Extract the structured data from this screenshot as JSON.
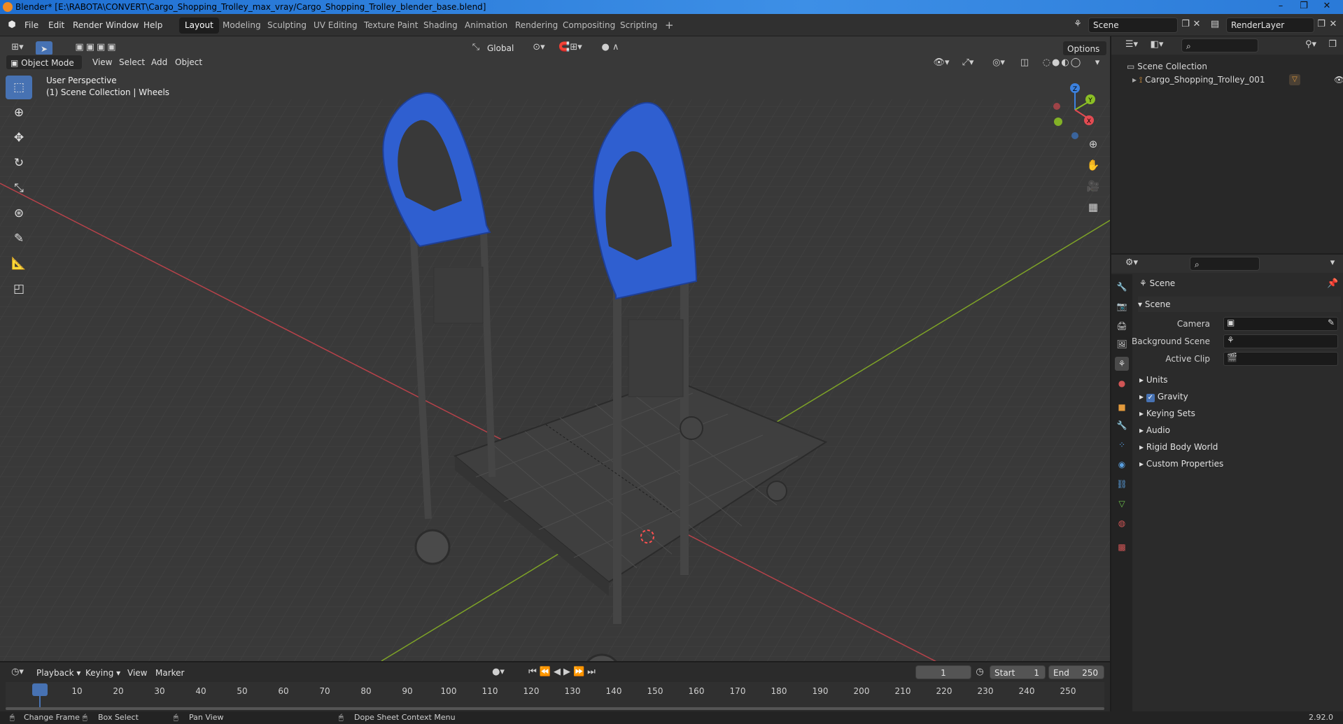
{
  "window": {
    "title": "Blender* [E:\\RABOTA\\CONVERT\\Cargo_Shopping_Trolley_max_vray/Cargo_Shopping_Trolley_blender_base.blend]",
    "controls": [
      "–",
      "❐",
      "✕"
    ]
  },
  "menu": [
    "File",
    "Edit",
    "Render",
    "Window",
    "Help"
  ],
  "workspaces": [
    {
      "label": "Layout",
      "active": true
    },
    {
      "label": "Modeling"
    },
    {
      "label": "Sculpting"
    },
    {
      "label": "UV Editing"
    },
    {
      "label": "Texture Paint"
    },
    {
      "label": "Shading"
    },
    {
      "label": "Animation"
    },
    {
      "label": "Rendering"
    },
    {
      "label": "Compositing"
    },
    {
      "label": "Scripting"
    }
  ],
  "add_workspace": "+",
  "scene_field": "Scene",
  "renderlayer_field": "RenderLayer",
  "viewport": {
    "mode": "Object Mode",
    "menus": [
      "View",
      "Select",
      "Add",
      "Object"
    ],
    "transform_orientation": "Global",
    "options": "Options",
    "perspective": "User Perspective",
    "collection": "(1) Scene Collection | Wheels",
    "gizmo": {
      "x": "X",
      "y": "Y",
      "z": "Z"
    }
  },
  "tools": [
    "select-box",
    "cursor",
    "move",
    "rotate",
    "scale",
    "transform",
    "annotate",
    "measure",
    "add-cube"
  ],
  "outliner": {
    "root": "Scene Collection",
    "items": [
      {
        "label": "Cargo_Shopping_Trolley_001"
      }
    ]
  },
  "properties": {
    "header": "Scene",
    "section": "Scene",
    "fields": [
      {
        "label": "Camera"
      },
      {
        "label": "Background Scene"
      },
      {
        "label": "Active Clip"
      }
    ],
    "panels": [
      {
        "label": "Units"
      },
      {
        "label": "Gravity",
        "checked": true
      },
      {
        "label": "Keying Sets"
      },
      {
        "label": "Audio"
      },
      {
        "label": "Rigid Body World"
      },
      {
        "label": "Custom Properties"
      }
    ]
  },
  "timeline": {
    "menus": [
      "Playback",
      "Keying",
      "View",
      "Marker"
    ],
    "current_frame": "1",
    "start_label": "Start",
    "start": "1",
    "end_label": "End",
    "end": "250",
    "ticks": [
      "1",
      "10",
      "20",
      "30",
      "40",
      "50",
      "60",
      "70",
      "80",
      "90",
      "100",
      "110",
      "120",
      "130",
      "140",
      "150",
      "160",
      "170",
      "180",
      "190",
      "200",
      "210",
      "220",
      "230",
      "240",
      "250"
    ]
  },
  "status": {
    "items": [
      "Change Frame",
      "Box Select",
      "Pan View",
      "Dope Sheet Context Menu"
    ],
    "version": "2.92.0"
  },
  "colors": {
    "accent": "#4772b3",
    "handle_blue": "#2f5fd0",
    "x_axis": "#e24b52",
    "y_axis": "#8bbf25",
    "z_axis": "#3c82e0",
    "viewport_bg": "#393939"
  }
}
